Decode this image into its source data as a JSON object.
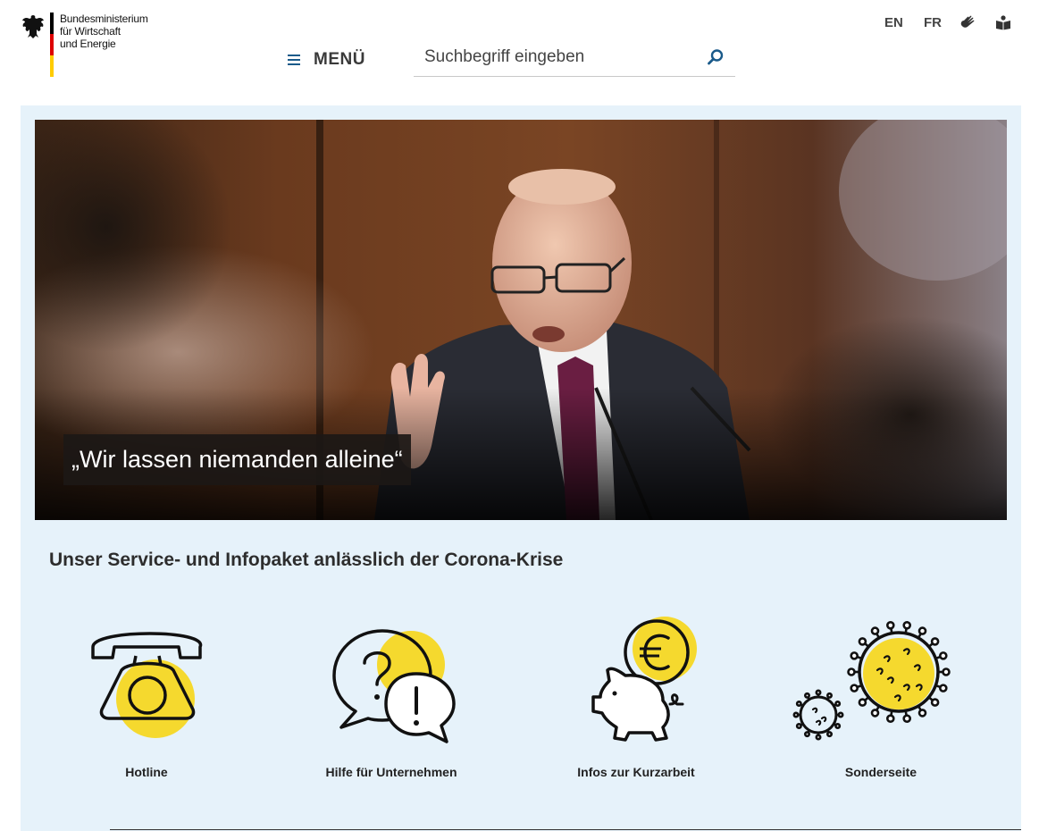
{
  "header": {
    "logo_lines": [
      "Bundesministerium",
      "für Wirtschaft",
      "und Energie"
    ],
    "menu_label": "MENÜ",
    "search_placeholder": "Suchbegriff eingeben",
    "languages": [
      "EN",
      "FR"
    ],
    "utility_icons": [
      "sign-language-icon",
      "easy-language-icon"
    ]
  },
  "hero": {
    "caption": "„Wir lassen niemanden alleine“"
  },
  "section": {
    "title": "Unser Service- und Infopaket anlässlich der Corona-Krise"
  },
  "tiles": [
    {
      "label": "Hotline",
      "icon": "telephone-icon"
    },
    {
      "label": "Hilfe für Unternehmen",
      "icon": "question-exclamation-icon"
    },
    {
      "label": "Infos zur Kurzarbeit",
      "icon": "piggy-bank-euro-icon"
    },
    {
      "label": "Sonderseite",
      "icon": "virus-icon"
    }
  ],
  "colors": {
    "accent_yellow": "#f5d92e",
    "panel_bg": "#e6f2fa",
    "menu_blue": "#1a5a8a"
  }
}
